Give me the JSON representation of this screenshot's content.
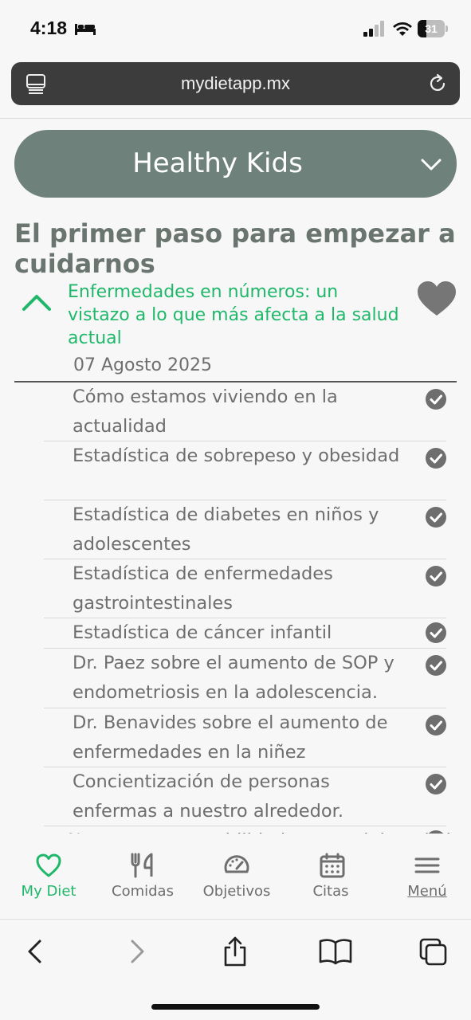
{
  "status_bar": {
    "time": "4:18",
    "battery": "31",
    "battery_level": 0.31
  },
  "browser": {
    "url": "mydietapp.mx"
  },
  "program_selector": {
    "label": "Healthy Kids"
  },
  "page_title": "El primer paso para empezar a cuidarnos",
  "module": {
    "title": "Enfermedades en números: un vistazo a lo que más afecta a la salud actual",
    "date": "07 Agosto 2025"
  },
  "lessons": [
    {
      "title": "Cómo estamos viviendo en la actualidad",
      "completed": true
    },
    {
      "title": "Estadística de sobrepeso y obesidad",
      "completed": true
    },
    {
      "title": "Estadística de diabetes en niños y adolescentes",
      "completed": true
    },
    {
      "title": "Estadística de enfermedades gastrointestinales",
      "completed": true
    },
    {
      "title": "Estadística de cáncer infantil",
      "completed": true
    },
    {
      "title": "Dr. Paez sobre el aumento de SOP y endometriosis en la adolescencia.",
      "completed": true
    },
    {
      "title": "Dr. Benavides sobre el aumento de enfermedades en la niñez",
      "completed": true
    },
    {
      "title": "Concientización de personas enfermas a nuestro alrededor.",
      "completed": true
    },
    {
      "title": "Nuestra responsabilidad como adultos de la salud",
      "completed": true
    }
  ],
  "bottom_nav": [
    {
      "label": "My Diet",
      "icon": "heart-outline-icon",
      "active": true
    },
    {
      "label": "Comidas",
      "icon": "fork-knife-icon",
      "active": false
    },
    {
      "label": "Objetivos",
      "icon": "speedometer-icon",
      "active": false
    },
    {
      "label": "Citas",
      "icon": "calendar-icon",
      "active": false
    },
    {
      "label": "Menú",
      "icon": "hamburger-menu-icon",
      "active": false
    }
  ],
  "colors": {
    "accent_green": "#1fb86b",
    "selector_bg": "#6e817a",
    "text_gray": "#6e6e6e"
  }
}
